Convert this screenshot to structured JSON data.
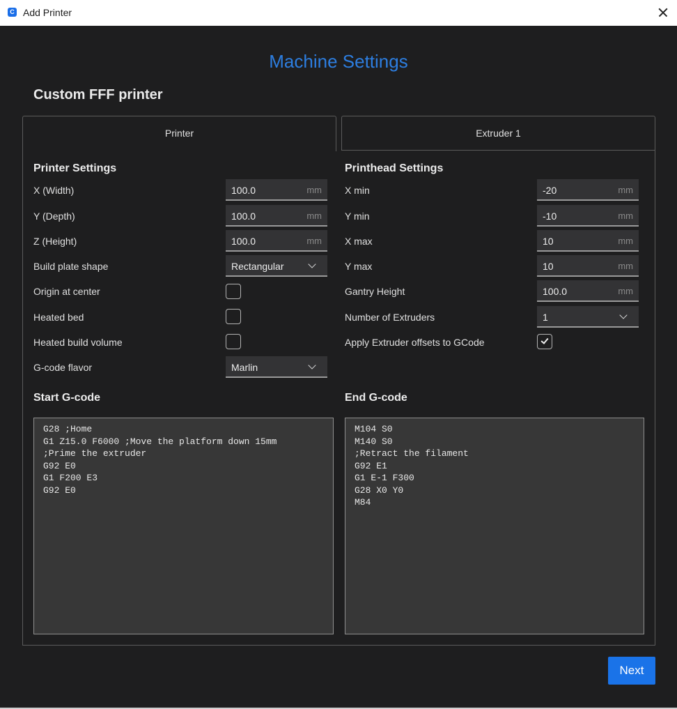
{
  "window": {
    "title": "Add Printer",
    "app_icon": "cura-logo-icon",
    "close_icon": "close-icon"
  },
  "colors": {
    "heading": "#2d7ee0",
    "background": "#1e1e1f",
    "field_bg": "#333335",
    "accent_button": "#1a73e8"
  },
  "header": {
    "title": "Machine Settings",
    "printer_name": "Custom FFF printer"
  },
  "tabs": [
    {
      "label": "Printer",
      "active": true
    },
    {
      "label": "Extruder 1",
      "active": false
    }
  ],
  "printer_settings": {
    "title": "Printer Settings",
    "x_width": {
      "label": "X (Width)",
      "value": "100.0",
      "unit": "mm"
    },
    "y_depth": {
      "label": "Y (Depth)",
      "value": "100.0",
      "unit": "mm"
    },
    "z_height": {
      "label": "Z (Height)",
      "value": "100.0",
      "unit": "mm"
    },
    "build_plate_shape": {
      "label": "Build plate shape",
      "value": "Rectangular"
    },
    "origin_at_center": {
      "label": "Origin at center",
      "checked": false
    },
    "heated_bed": {
      "label": "Heated bed",
      "checked": false
    },
    "heated_build_volume": {
      "label": "Heated build volume",
      "checked": false
    },
    "gcode_flavor": {
      "label": "G-code flavor",
      "value": "Marlin"
    }
  },
  "printhead_settings": {
    "title": "Printhead Settings",
    "x_min": {
      "label": "X min",
      "value": "-20",
      "unit": "mm"
    },
    "y_min": {
      "label": "Y min",
      "value": "-10",
      "unit": "mm"
    },
    "x_max": {
      "label": "X max",
      "value": "10",
      "unit": "mm"
    },
    "y_max": {
      "label": "Y max",
      "value": "10",
      "unit": "mm"
    },
    "gantry_height": {
      "label": "Gantry Height",
      "value": "100.0",
      "unit": "mm"
    },
    "number_of_extruders": {
      "label": "Number of Extruders",
      "value": "1"
    },
    "apply_extruder_offsets": {
      "label": "Apply Extruder offsets to GCode",
      "checked": true
    }
  },
  "start_gcode": {
    "title": "Start G-code",
    "lines": [
      "G28 ;Home",
      "G1 Z15.0 F6000 ;Move the platform down 15mm",
      ";Prime the extruder",
      "G92 E0",
      "G1 F200 E3",
      "G92 E0"
    ]
  },
  "end_gcode": {
    "title": "End G-code",
    "lines": [
      "M104 S0",
      "M140 S0",
      ";Retract the filament",
      "G92 E1",
      "G1 E-1 F300",
      "G28 X0 Y0",
      "M84"
    ]
  },
  "footer": {
    "next_label": "Next"
  }
}
